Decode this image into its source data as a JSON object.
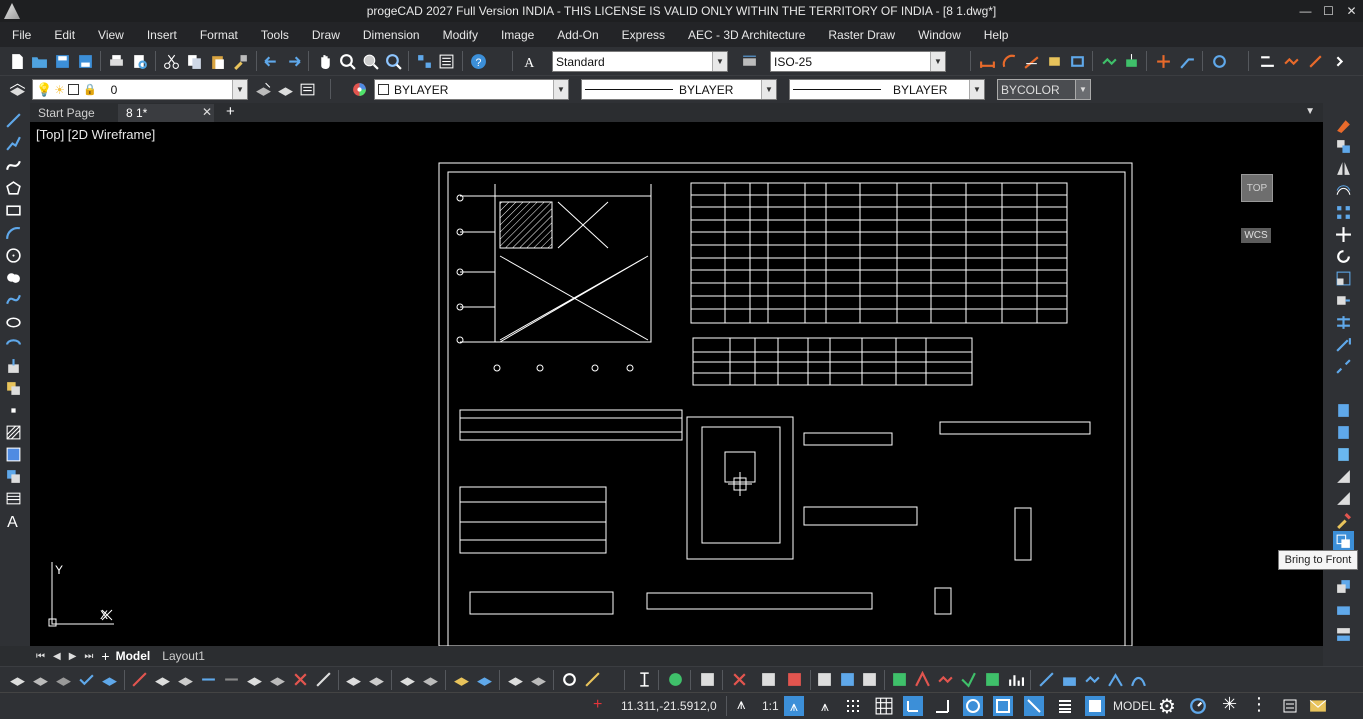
{
  "window": {
    "title": "progeCAD 2027 Full Version INDIA - THIS LICENSE IS VALID ONLY WITHIN THE TERRITORY OF INDIA - [8 1.dwg*]",
    "minimize": "—",
    "maximize": "☐",
    "close": "✕"
  },
  "menu": [
    "File",
    "Edit",
    "View",
    "Insert",
    "Format",
    "Tools",
    "Draw",
    "Dimension",
    "Modify",
    "Image",
    "Add-On",
    "Express",
    "AEC - 3D Architecture",
    "Raster Draw",
    "Window",
    "Help"
  ],
  "toolbar": {
    "text_style": "Standard",
    "dim_style": "ISO-25",
    "layer": "0",
    "color": "BYLAYER",
    "linetype": "BYLAYER",
    "lineweight": "BYLAYER",
    "plot_style": "BYCOLOR"
  },
  "tabs": {
    "start": "Start Page",
    "drawing": "8 1*",
    "close": "✕",
    "add": "+"
  },
  "viewport": {
    "label": "[Top]  [2D Wireframe]",
    "nav_cube": "TOP",
    "wcs": "WCS",
    "axis_y": "Y",
    "axis_x": "X"
  },
  "layout_tabs": {
    "model": "Model",
    "layout1": "Layout1"
  },
  "tooltip": "Bring to Front",
  "status": {
    "coords": "11.311,-21.5912,0",
    "scale": "1:1",
    "mode": "MODEL"
  }
}
